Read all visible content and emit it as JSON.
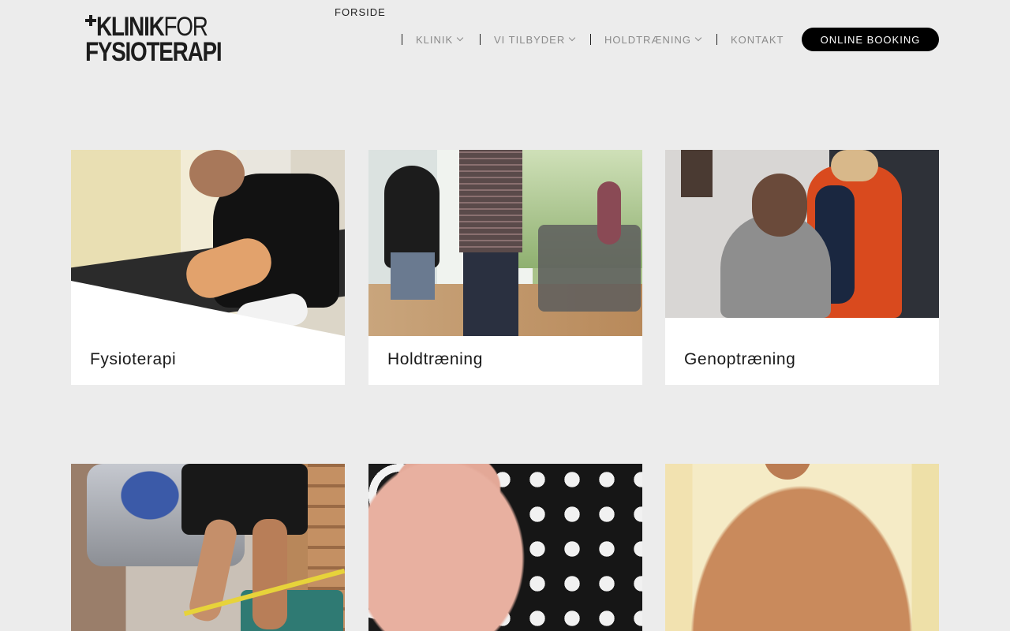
{
  "brand": {
    "logo_line1_bold": "KLINIK",
    "logo_line1_thin": "FOR",
    "logo_line2": "FYSIOTERAPI"
  },
  "nav": {
    "items": [
      {
        "label": "Forside",
        "active": true,
        "dropdown": false
      },
      {
        "label": "Klinik",
        "active": false,
        "dropdown": true
      },
      {
        "label": "Vi tilbyder",
        "active": false,
        "dropdown": true
      },
      {
        "label": "Holdtræning",
        "active": false,
        "dropdown": true
      },
      {
        "label": "Kontakt",
        "active": false,
        "dropdown": false
      }
    ],
    "cta_label": "Online booking"
  },
  "cards": [
    {
      "title": "Fysioterapi"
    },
    {
      "title": "Holdtræning"
    },
    {
      "title": "Genoptræning"
    },
    {
      "title": ""
    },
    {
      "title": ""
    },
    {
      "title": ""
    }
  ],
  "colors": {
    "background": "#ececec",
    "card": "#ffffff",
    "text": "#1a1a1a",
    "nav_muted": "#8a8a8a",
    "cta_bg": "#000000",
    "cta_text": "#ffffff"
  }
}
